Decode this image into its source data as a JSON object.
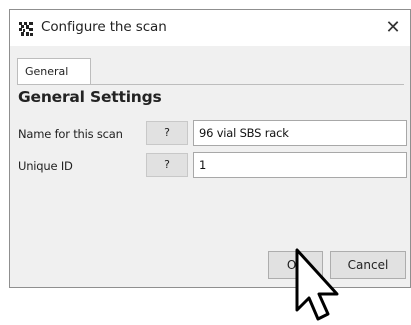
{
  "window": {
    "title": "Configure the scan",
    "close_label": "✕",
    "icon": "app-grid-icon"
  },
  "tabs": [
    {
      "label": "General",
      "selected": true
    }
  ],
  "section": {
    "title": "General Settings"
  },
  "fields": [
    {
      "label": "Name for this scan",
      "help_label": "?",
      "value": "96 vial SBS rack"
    },
    {
      "label": "Unique ID",
      "help_label": "?",
      "value": "1"
    }
  ],
  "buttons": {
    "ok_label": "OK",
    "cancel_label": "Cancel"
  },
  "cursor": {
    "icon": "mouse-pointer-icon"
  }
}
